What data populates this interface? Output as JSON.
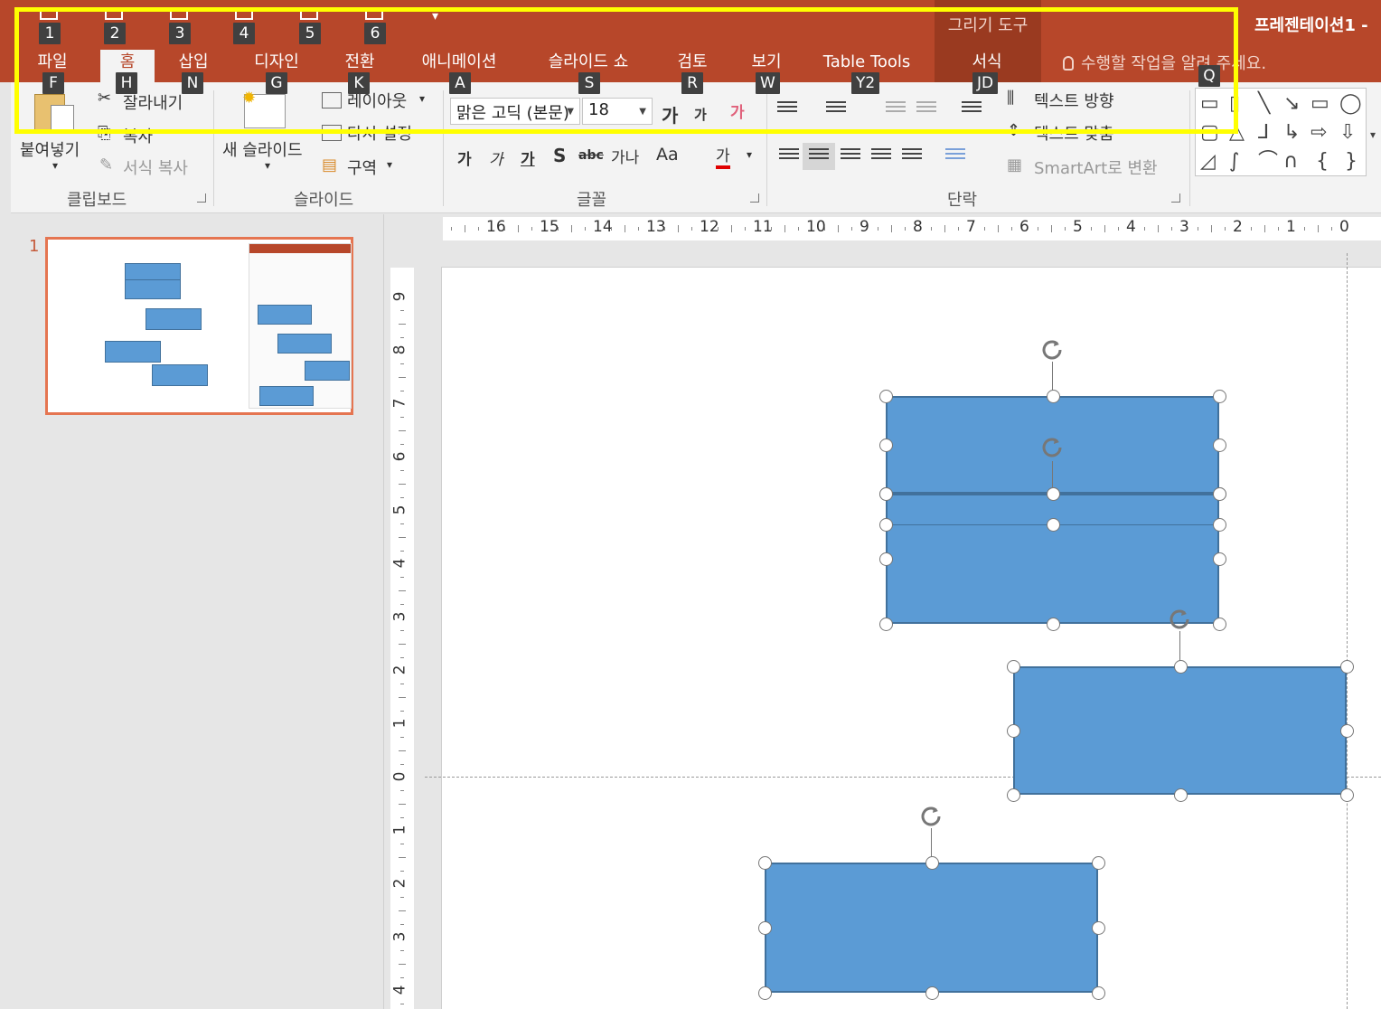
{
  "doc_title": "프레젠테이션1 -",
  "contextual_group": "그리기 도구",
  "quick_access_keytips": [
    "1",
    "2",
    "3",
    "4",
    "5",
    "6"
  ],
  "tabs": [
    {
      "label": "파일",
      "keytip": "F"
    },
    {
      "label": "홈",
      "keytip": "H"
    },
    {
      "label": "삽입",
      "keytip": "N"
    },
    {
      "label": "디자인",
      "keytip": "G"
    },
    {
      "label": "전환",
      "keytip": "K"
    },
    {
      "label": "애니메이션",
      "keytip": "A"
    },
    {
      "label": "슬라이드 쇼",
      "keytip": "S"
    },
    {
      "label": "검토",
      "keytip": "R"
    },
    {
      "label": "보기",
      "keytip": "W"
    },
    {
      "label": "Table Tools",
      "keytip": "Y2"
    },
    {
      "label": "서식",
      "keytip": "JD"
    }
  ],
  "active_tab": "홈",
  "tell_me": {
    "text": "수행할 작업을 알려 주세요.",
    "keytip": "Q"
  },
  "ribbon": {
    "clipboard": {
      "paste": "붙여넣기",
      "cut": "잘라내기",
      "copy": "복사",
      "format_painter": "서식 복사",
      "group": "클립보드"
    },
    "slides": {
      "new_slide": "새 슬라이드",
      "layout": "레이아웃",
      "reset": "다시 설정",
      "section": "구역",
      "group": "슬라이드"
    },
    "font": {
      "name": "맑은 고딕 (본문)",
      "size": "18",
      "grow": "가",
      "shrink": "가",
      "clear": "가",
      "bold": "가",
      "italic": "가",
      "underline": "가",
      "shadow": "S",
      "strike": "abc",
      "spacing": "가나",
      "case": "Aa",
      "color": "가",
      "group": "글꼴"
    },
    "paragraph": {
      "group": "단락"
    },
    "drawing": {
      "text_direction": "텍스트 방향",
      "align_text": "텍스트 맞춤",
      "smartart": "SmartArt로 변환"
    }
  },
  "slide_panel": {
    "slide_number": "1"
  },
  "hruler_labels": [
    "16",
    "15",
    "14",
    "13",
    "12",
    "11",
    "10",
    "9",
    "8",
    "7",
    "6",
    "5",
    "4",
    "3",
    "2",
    "1",
    "0"
  ],
  "vruler_labels": [
    "9",
    "8",
    "7",
    "6",
    "5",
    "4",
    "3",
    "2",
    "1",
    "0",
    "1",
    "2",
    "3",
    "4"
  ],
  "colors": {
    "accent": "#b7472a",
    "shape_fill": "#5b9bd5",
    "shape_border": "#41719c",
    "highlight": "#ffff00"
  }
}
